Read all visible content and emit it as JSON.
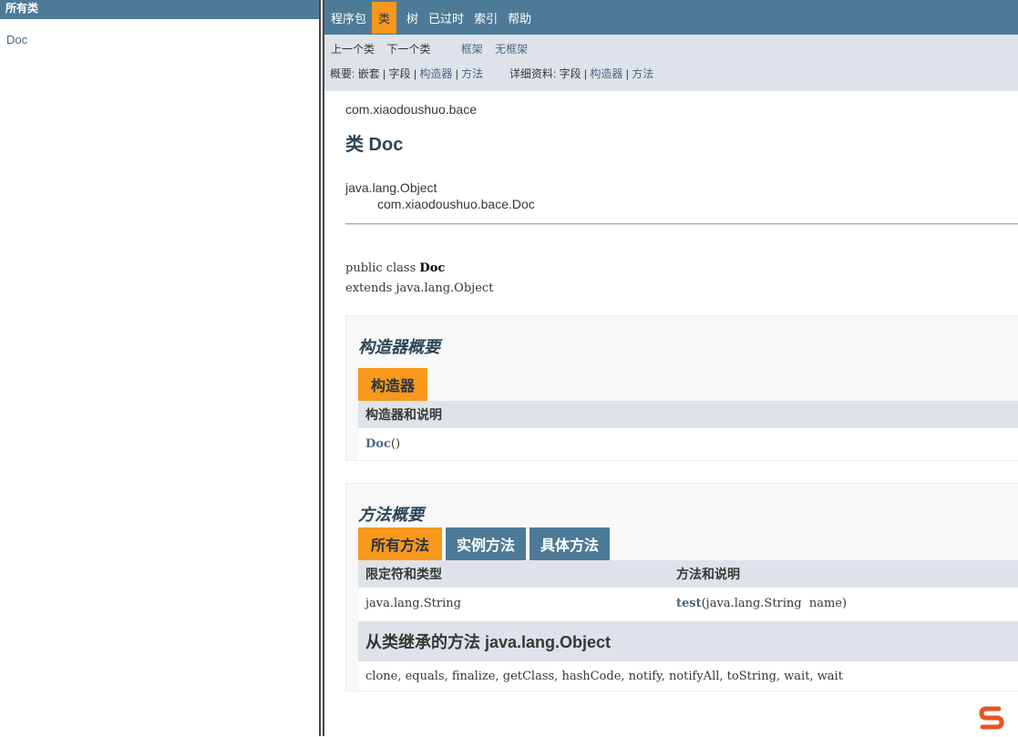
{
  "left_frame": {
    "header": "所有类",
    "items": [
      "Doc"
    ]
  },
  "top_nav": {
    "items": [
      "程序包",
      "类",
      "树",
      "已过时",
      "索引",
      "帮助"
    ],
    "active": "类"
  },
  "sub_nav": {
    "prev_class": "上一个类",
    "next_class": "下一个类",
    "frames": "框架",
    "no_frames": "无框架",
    "summary_label": "概要:",
    "summary_nested": "嵌套",
    "summary_field": "字段",
    "summary_constructor": "构造器",
    "summary_method": "方法",
    "detail_label": "详细资料:",
    "detail_field": "字段",
    "detail_constructor": "构造器",
    "detail_method": "方法",
    "separator": "|"
  },
  "header": {
    "package": "com.xiaodoushuo.bace",
    "title": "类 Doc"
  },
  "inheritance": {
    "parent": "java.lang.Object",
    "child": "com.xiaodoushuo.bace.Doc"
  },
  "signature": {
    "prefix": "public class ",
    "name": "Doc",
    "extends": "extends java.lang.Object"
  },
  "constructor_summary": {
    "heading": "构造器概要",
    "tab": "构造器",
    "column": "构造器和说明",
    "rows": [
      {
        "name": "Doc",
        "params": "()"
      }
    ]
  },
  "method_summary": {
    "heading": "方法概要",
    "tabs": [
      "所有方法",
      "实例方法",
      "具体方法"
    ],
    "columns": [
      "限定符和类型",
      "方法和说明"
    ],
    "rows": [
      {
        "type": "java.lang.String",
        "name": "test",
        "params": "(java.lang.String  name)"
      }
    ]
  },
  "inherited": {
    "heading": "从类继承的方法 java.lang.Object",
    "methods": "clone, equals, finalize, getClass, hashCode, notify, notifyAll, toString, wait, wait"
  },
  "colors": {
    "nav_bg": "#4d7a97",
    "accent": "#f8981d",
    "subnav_bg": "#dee3e9",
    "link": "#4a6782"
  },
  "ime_icon": "sogou-s-icon"
}
